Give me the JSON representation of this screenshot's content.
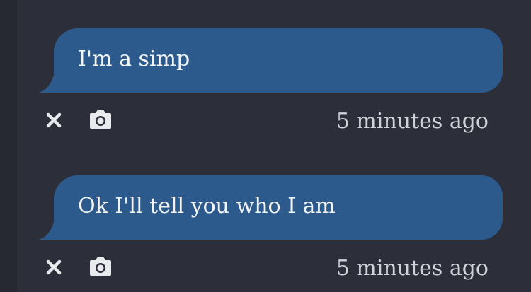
{
  "messages": [
    {
      "text": "I'm a simp",
      "time": "5 minutes ago"
    },
    {
      "text": "Ok I'll tell you who I am",
      "time": "5 minutes ago"
    }
  ],
  "icons": {
    "delete": "close-icon",
    "capture": "camera-icon"
  },
  "colors": {
    "background": "#2c2f3a",
    "bubble": "#2c5a8c",
    "text": "#f3f4f6",
    "muted": "#cfd2d8"
  }
}
